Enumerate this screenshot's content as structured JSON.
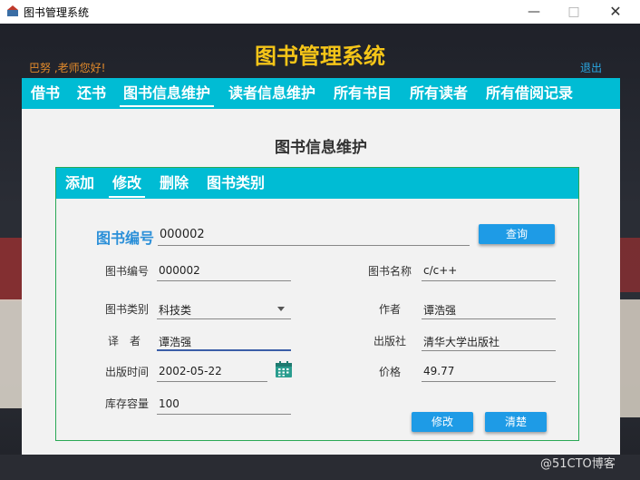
{
  "window": {
    "title": "图书管理系统"
  },
  "header": {
    "app_title": "图书管理系统",
    "greeting": "巴努 ,老师您好!",
    "logout": "退出"
  },
  "nav": {
    "items": [
      "借书",
      "还书",
      "图书信息维护",
      "读者信息维护",
      "所有书目",
      "所有读者",
      "所有借阅记录"
    ],
    "active": "图书信息维护"
  },
  "section": {
    "title": "图书信息维护"
  },
  "tabs": {
    "items": [
      "添加",
      "修改",
      "删除",
      "图书类别"
    ],
    "active": "修改"
  },
  "search": {
    "label": "图书编号",
    "value": "000002",
    "button": "查询"
  },
  "form": {
    "book_id": {
      "label": "图书编号",
      "value": "000002"
    },
    "book_name": {
      "label": "图书名称",
      "value": "c/c++"
    },
    "category": {
      "label": "图书类别",
      "value": "科技类"
    },
    "author": {
      "label": "作者",
      "value": "谭浩强"
    },
    "translator": {
      "label": "译　者",
      "value": "谭浩强"
    },
    "publisher": {
      "label": "出版社",
      "value": "清华大学出版社"
    },
    "pub_date": {
      "label": "出版时间",
      "value": "2002-05-22"
    },
    "price": {
      "label": "价格",
      "value": "49.77"
    },
    "stock": {
      "label": "库存容量",
      "value": "100"
    }
  },
  "actions": {
    "modify": "修改",
    "clear": "清楚"
  },
  "watermark": "@51CTO博客",
  "colors": {
    "accent": "#00bcd4",
    "title": "#f5c518",
    "button": "#1e9be6",
    "panel_border": "#2aa855"
  }
}
